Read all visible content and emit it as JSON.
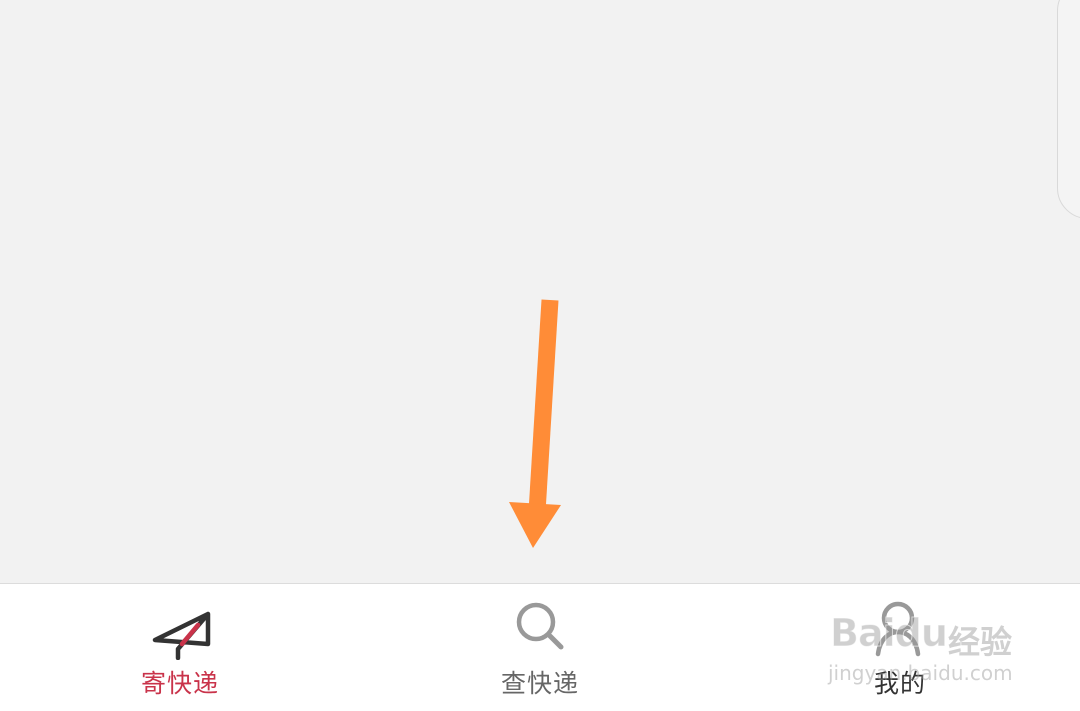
{
  "tab_bar": {
    "items": [
      {
        "label": "寄快递",
        "icon": "paper-plane-icon",
        "active": true
      },
      {
        "label": "查快递",
        "icon": "search-icon",
        "active": false
      },
      {
        "label": "我的",
        "icon": "user-icon",
        "active": false
      }
    ]
  },
  "colors": {
    "active": "#c9334a",
    "inactive": "#666666",
    "arrow": "#ff8c37",
    "background": "#f2f2f2",
    "tab_bar_background": "#ffffff"
  },
  "watermark": {
    "brand": "Baidu",
    "brand_cn": "经验",
    "url": "jingyan.baidu.com"
  }
}
